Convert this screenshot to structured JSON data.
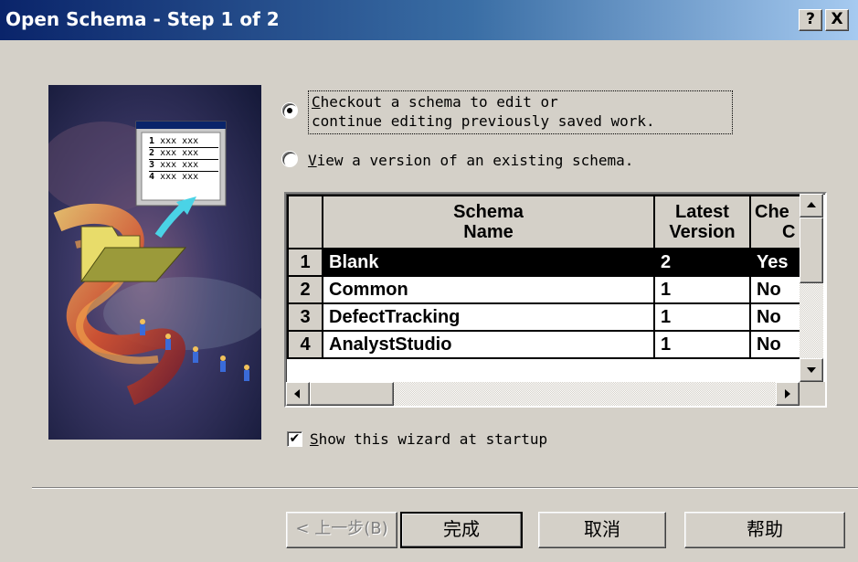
{
  "window": {
    "title": "Open Schema - Step 1 of 2",
    "help_glyph": "?",
    "close_glyph": "X"
  },
  "options": {
    "checkout": {
      "line1": "Checkout a schema to edit or",
      "line2": "continue editing previously saved work.",
      "accel": "C",
      "selected": true
    },
    "view": {
      "label": "View a version of an existing schema.",
      "accel": "V",
      "selected": false
    }
  },
  "wizard_image": {
    "list_items": [
      {
        "num": "1",
        "text": "xxx xxx"
      },
      {
        "num": "2",
        "text": "xxx xxx"
      },
      {
        "num": "3",
        "text": "xxx xxx"
      },
      {
        "num": "4",
        "text": "xxx xxx"
      }
    ]
  },
  "grid": {
    "columns": [
      "",
      "Schema\nName",
      "Latest\nVersion",
      "Che\nC"
    ],
    "col_schema_l1": "Schema",
    "col_schema_l2": "Name",
    "col_version_l1": "Latest",
    "col_version_l2": "Version",
    "col_check_l1": "Che",
    "col_check_l2": "C",
    "rows": [
      {
        "num": "1",
        "name": "Blank",
        "version": "2",
        "checked": "Yes"
      },
      {
        "num": "2",
        "name": "Common",
        "version": "1",
        "checked": "No"
      },
      {
        "num": "3",
        "name": "DefectTracking",
        "version": "1",
        "checked": "No"
      },
      {
        "num": "4",
        "name": "AnalystStudio",
        "version": "1",
        "checked": "No"
      }
    ],
    "selected_row": 1
  },
  "startup": {
    "label": "Show this wizard at startup",
    "accel": "S",
    "checked": true,
    "check_glyph": "✔"
  },
  "buttons": {
    "back": "< 上一步(B)",
    "finish": "完成",
    "cancel": "取消",
    "help": "帮助"
  }
}
